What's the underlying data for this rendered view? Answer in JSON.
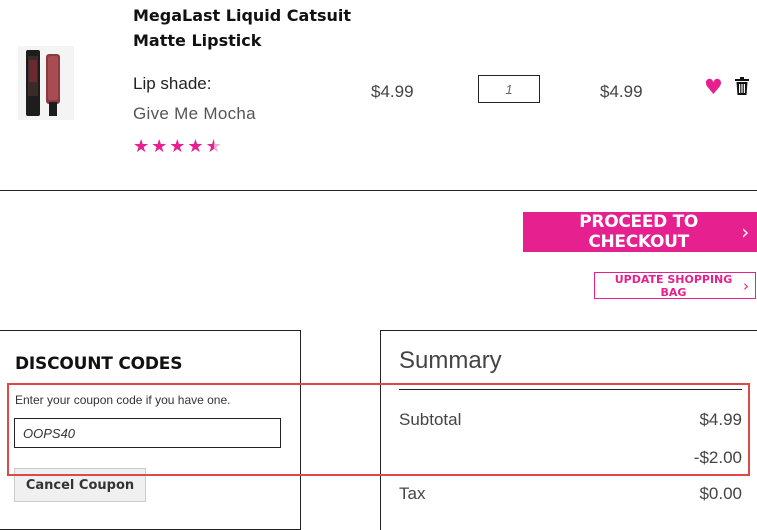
{
  "product": {
    "name_line1": "MegaLast Liquid Catsuit",
    "name_line2": "Matte Lipstick",
    "shade_label": "Lip shade:",
    "shade_value": "Give Me Mocha",
    "rating": 4.5,
    "rating_max": 5,
    "price": "$4.99",
    "quantity": "1",
    "total": "$4.99",
    "heart_icon": "heart-icon",
    "trash_icon": "trash-icon"
  },
  "actions": {
    "checkout_label": "PROCEED TO CHECKOUT",
    "update_label": "UPDATE SHOPPING BAG",
    "chevron_icon": "chevron-right-icon"
  },
  "discount": {
    "title": "DISCOUNT CODES",
    "help_text": "Enter your coupon code if you have one.",
    "coupon_value": "OOPS40",
    "cancel_label": "Cancel Coupon"
  },
  "summary": {
    "title": "Summary",
    "subtotal_label": "Subtotal",
    "subtotal_value": "$4.99",
    "discount_value": "-$2.00",
    "tax_label": "Tax",
    "tax_value": "$0.00"
  },
  "colors": {
    "accent": "#e6208f",
    "highlight": "#e04848"
  }
}
